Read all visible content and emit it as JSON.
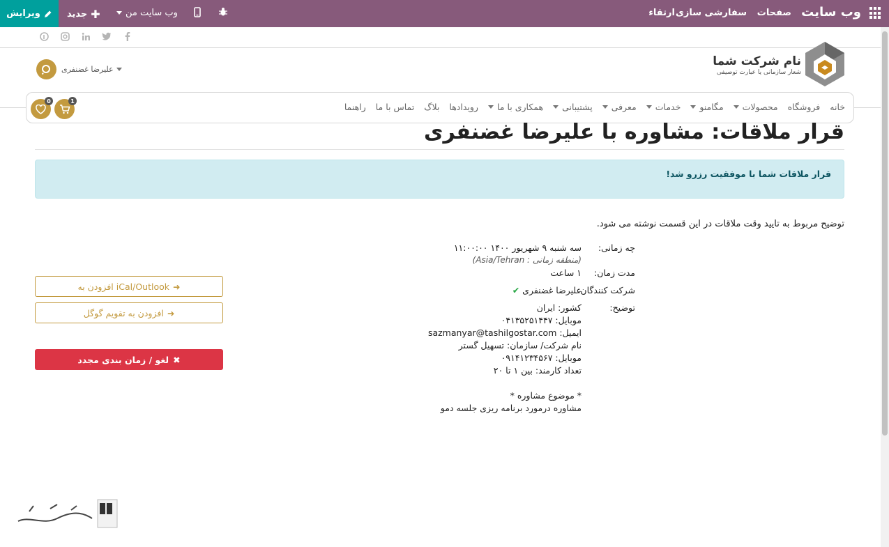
{
  "topbar": {
    "brand": "وب سایت",
    "menu": [
      "صفحات",
      "سفارشی سازی",
      "ارتقاء"
    ],
    "new_label": "جدید",
    "my_website_label": "وب سایت من",
    "edit_label": "ویرایش"
  },
  "header": {
    "company_name": "نام شرکت شما",
    "slogan": "شعار سازمانی یا عبارت توصیفی",
    "user_name": "علیرضا غضنفری"
  },
  "nav": {
    "items": [
      {
        "label": "خانه",
        "dropdown": false
      },
      {
        "label": "فروشگاه",
        "dropdown": false
      },
      {
        "label": "محصولات",
        "dropdown": true
      },
      {
        "label": "مگامنو",
        "dropdown": true
      },
      {
        "label": "خدمات",
        "dropdown": true
      },
      {
        "label": "معرفی",
        "dropdown": true
      },
      {
        "label": "پشتیبانی",
        "dropdown": true
      },
      {
        "label": "همکاری با ما",
        "dropdown": true
      },
      {
        "label": "رویدادها",
        "dropdown": false
      },
      {
        "label": "بلاگ",
        "dropdown": false
      },
      {
        "label": "تماس با ما",
        "dropdown": false
      },
      {
        "label": "راهنما",
        "dropdown": false
      }
    ],
    "cart_count": "1",
    "wishlist_count": "0"
  },
  "page": {
    "title": "قرار ملاقات: مشاوره با علیرضا غضنفری",
    "alert": "قرار ملاقات شما با موفقیت رزرو شد!",
    "description": "توضیح مربوط به تایید وقت ملاقات در این قسمت نوشته می شود."
  },
  "details": {
    "when_label": "چه زمانی:",
    "when_value": "سه شنبه ۹ شهریور ۱۴۰۰ ۱۱:۰۰:۰۰",
    "timezone": "(منطقه زمانی : Asia/Tehran)",
    "duration_label": "مدت زمان:",
    "duration_value": "۱ ساعت",
    "attendees_label": "شرکت کنندگان:",
    "attendee": "علیرضا غضنفری",
    "notes_label": "توضیح:",
    "notes": [
      "کشور: ایران",
      "موبایل: ۰۴۱۳۵۲۵۱۴۴۷",
      "ایمیل: sazmanyar@tashilgostar.com",
      "نام شرکت/ سازمان: تسهیل گستر",
      "موبایل: ۰۹۱۴۱۲۳۴۵۶۷",
      "تعداد کارمند: بین ۱ تا ۲۰",
      "",
      "* موضوع مشاوره *",
      "مشاوره درمورد برنامه ریزی جلسه دمو"
    ]
  },
  "actions": {
    "ical_label": "افزودن به iCal/Outlook",
    "google_label": "افزودن به تقویم گوگل",
    "cancel_label": "لغو / زمان بندی مجدد"
  },
  "colors": {
    "topbar": "#875a7b",
    "edit": "#00a09d",
    "accent": "#c39a3f",
    "danger": "#dc3545",
    "alert_bg": "#d1ecf1"
  }
}
